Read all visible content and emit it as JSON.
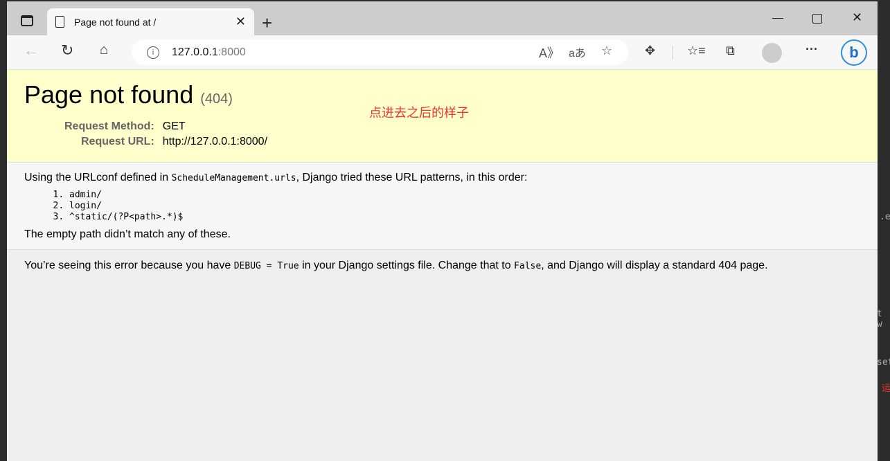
{
  "browser": {
    "tab_title": "Page not found at /",
    "url_host": "127.0.0.1",
    "url_port": ":8000"
  },
  "page": {
    "title": "Page not found",
    "status": "(404)",
    "annotation": "点进去之后的样子",
    "meta": [
      {
        "label": "Request Method:",
        "value": "GET"
      },
      {
        "label": "Request URL:",
        "value": "http://127.0.0.1:8000/"
      }
    ],
    "info_prefix": "Using the URLconf defined in ",
    "urlconf": "ScheduleManagement.urls",
    "info_suffix": ", Django tried these URL patterns, in this order:",
    "patterns": [
      "admin/",
      "login/",
      "^static/(?P<path>.*)$"
    ],
    "no_match": "The empty path didn’t match any of these.",
    "expl_1": "You’re seeing this error because you have ",
    "debug_code": "DEBUG = True",
    "expl_2": " in your Django settings file. Change that to ",
    "false_code": "False",
    "expl_3": ", and Django will display a standard 404 page."
  },
  "background_editor": {
    "lines": [
      ".ex",
      "t w",
      "set",
      "运"
    ]
  }
}
